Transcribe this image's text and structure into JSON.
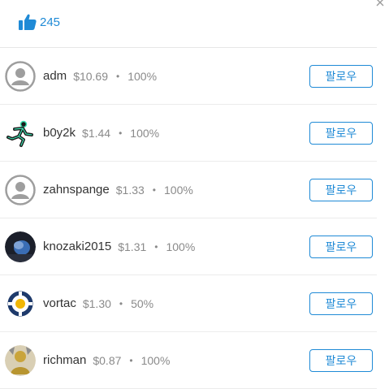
{
  "header": {
    "like_count": "245"
  },
  "colors": {
    "accent": "#1f8ad6",
    "text": "#333333",
    "muted": "#8a8a8a"
  },
  "follow_label": "팔로우",
  "voters": [
    {
      "username": "adm",
      "amount": "$10.69",
      "percent": "100%",
      "avatar": "default-avatar"
    },
    {
      "username": "b0y2k",
      "amount": "$1.44",
      "percent": "100%",
      "avatar": "running-figure"
    },
    {
      "username": "zahnspange",
      "amount": "$1.33",
      "percent": "100%",
      "avatar": "default-avatar"
    },
    {
      "username": "knozaki2015",
      "amount": "$1.31",
      "percent": "100%",
      "avatar": "photo"
    },
    {
      "username": "vortac",
      "amount": "$1.30",
      "percent": "50%",
      "avatar": "ring-logo"
    },
    {
      "username": "richman",
      "amount": "$0.87",
      "percent": "100%",
      "avatar": "photo"
    }
  ]
}
